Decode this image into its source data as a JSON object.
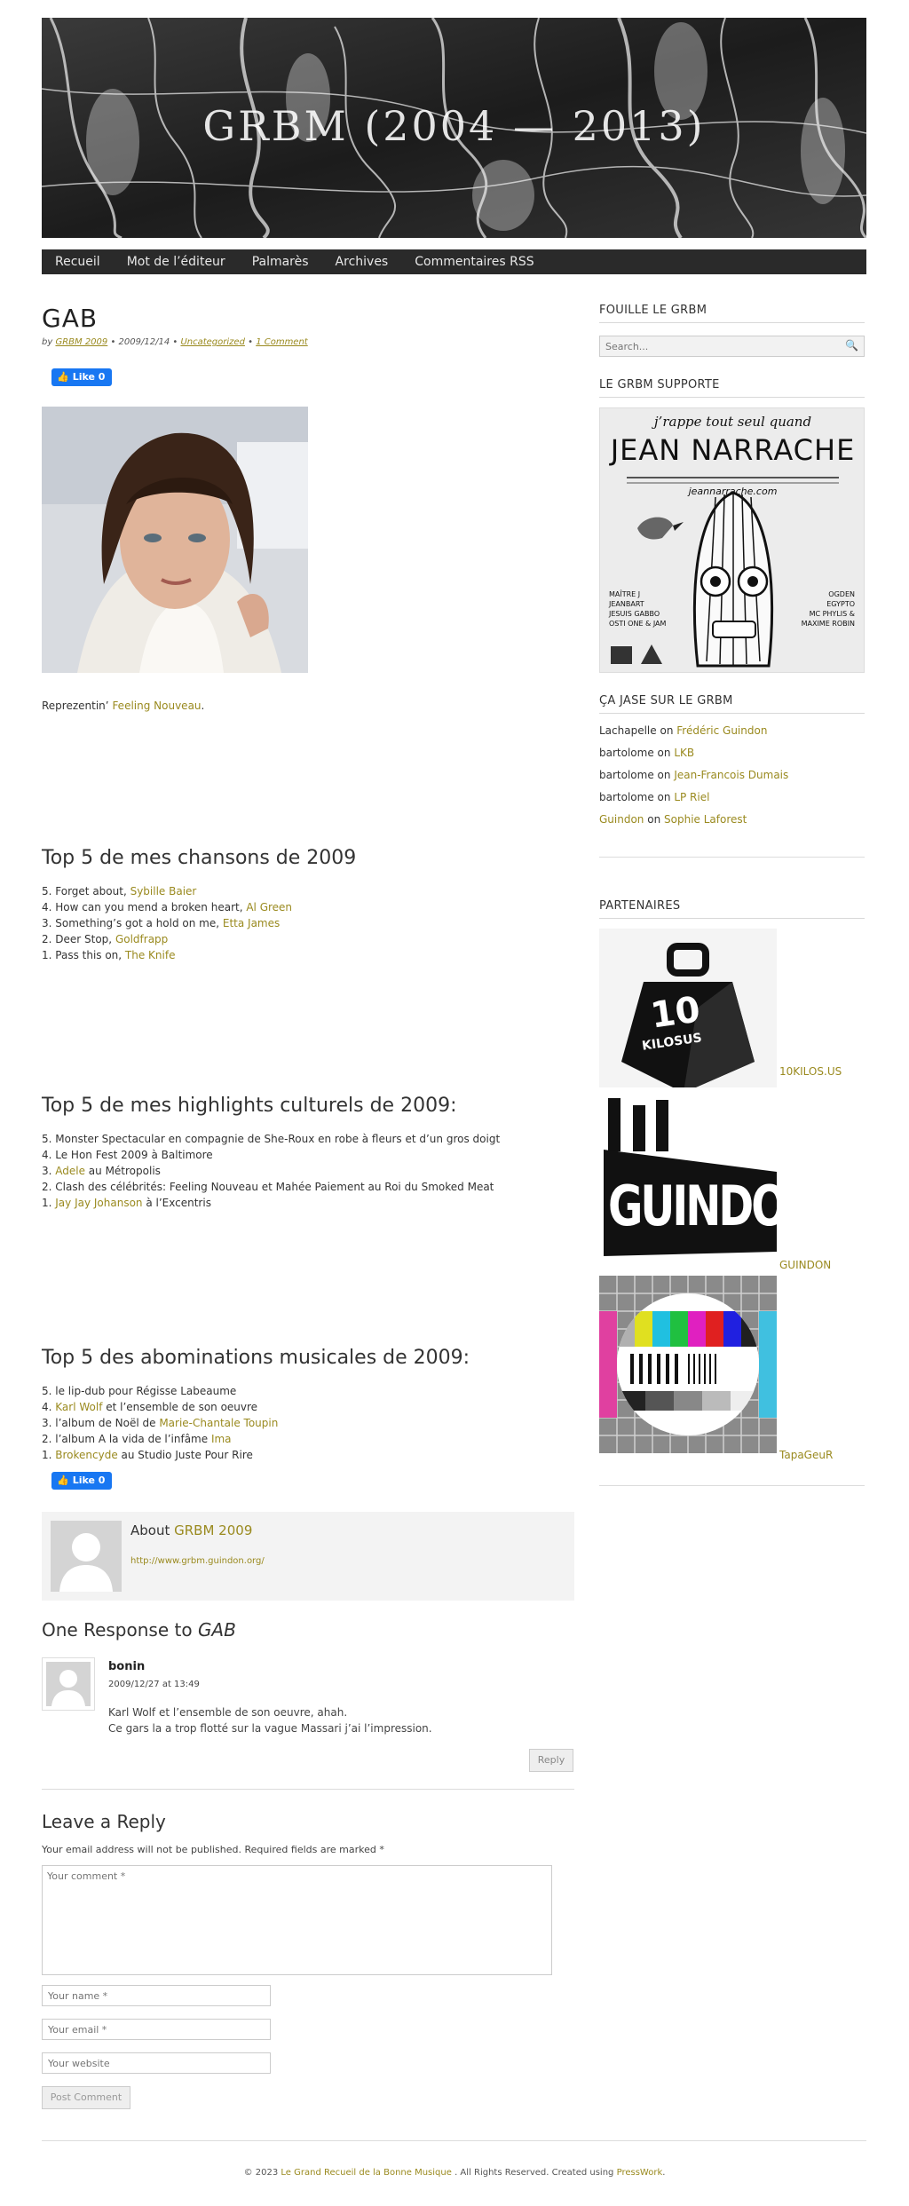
{
  "header": {
    "site_title": "GRBM (2004 — 2013)"
  },
  "nav": {
    "items": [
      "Recueil",
      "Mot de l’éditeur",
      "Palmarès",
      "Archives",
      "Commentaires RSS"
    ]
  },
  "post": {
    "title": "GAB",
    "meta": {
      "by": "by",
      "author": "GRBM 2009",
      "date": "2009/12/14",
      "category": "Uncategorized",
      "comments_link": "1 Comment"
    },
    "like_label": "Like 0",
    "intro": {
      "prefix": "Reprezentin’",
      "link": "Feeling Nouveau",
      "suffix": "."
    },
    "sections": [
      {
        "heading": "Top 5 de mes chansons de 2009",
        "items": [
          {
            "text": "5. Forget about, ",
            "link": "Sybille Baier",
            "after": ""
          },
          {
            "text": "4. How can you mend a broken heart, ",
            "link": "Al Green",
            "after": ""
          },
          {
            "text": "3. Something’s got a hold on me, ",
            "link": "Etta James",
            "after": ""
          },
          {
            "text": "2. Deer Stop, ",
            "link": "Goldfrapp",
            "after": ""
          },
          {
            "text": "1. Pass this on, ",
            "link": "The Knife",
            "after": ""
          }
        ]
      },
      {
        "heading": "Top 5 de mes highlights culturels de 2009:",
        "items": [
          {
            "text": "5. Monster Spectacular en compagnie de She-Roux en robe à fleurs et d’un gros doigt",
            "link": "",
            "after": ""
          },
          {
            "text": "4. Le Hon Fest 2009 à Baltimore",
            "link": "",
            "after": ""
          },
          {
            "text": "3. ",
            "link": "Adele",
            "after": " au Métropolis"
          },
          {
            "text": "2. Clash des célébrités: Feeling Nouveau et Mahée Paiement au Roi du Smoked Meat",
            "link": "",
            "after": ""
          },
          {
            "text": "1. ",
            "link": "Jay Jay Johanson",
            "after": " à l’Excentris"
          }
        ]
      },
      {
        "heading": "Top 5 des abominations musicales de 2009:",
        "items": [
          {
            "text": "5. le lip-dub pour Régisse Labeaume",
            "link": "",
            "after": ""
          },
          {
            "text": "4. ",
            "link": "Karl Wolf",
            "after": " et l’ensemble de son oeuvre"
          },
          {
            "text": "3. l’album de Noël de ",
            "link": "Marie-Chantale Toupin",
            "after": ""
          },
          {
            "text": "2. l’album A la vida de l’infâme ",
            "link": "Ima",
            "after": ""
          },
          {
            "text": "1. ",
            "link": "Brokencyde",
            "after": " au Studio Juste Pour Rire"
          }
        ]
      }
    ]
  },
  "author_box": {
    "about": "About",
    "name": "GRBM 2009",
    "url": "http://www.grbm.guindon.org/"
  },
  "responses": {
    "title_prefix": "One Response to",
    "title_post": "GAB",
    "comment": {
      "author": "bonin",
      "date": "2009/12/27 at 13:49",
      "lines": [
        "Karl Wolf et l’ensemble de son oeuvre, ahah.",
        "Ce gars la a trop flotté sur la vague Massari j’ai l’impression."
      ],
      "reply_label": "Reply"
    }
  },
  "reply_form": {
    "title": "Leave a Reply",
    "note": "Your email address will not be published. Required fields are marked *",
    "comment_placeholder": "Your comment *",
    "name_placeholder": "Your name *",
    "email_placeholder": "Your email *",
    "website_placeholder": "Your website",
    "submit_label": "Post Comment"
  },
  "sidebar": {
    "search_title": "FOUILLE LE GRBM",
    "search_placeholder": "Search...",
    "support_title": "LE GRBM SUPPORTE",
    "poster": {
      "tagline": "j’rappe tout seul quand",
      "name": "JEAN NARRACHE",
      "site": "jeannarrache.com",
      "left_names": [
        "MAÎTRE J",
        "JEANBART",
        "JESUIS GABBO",
        "OSTI ONE & JAM"
      ],
      "right_names": [
        "OGDEN",
        "EGYPTO",
        "MC PHYLIS &",
        "MAXIME ROBIN"
      ]
    },
    "recent_title": "ÇA JASE SUR LE GRBM",
    "recent_comments": [
      {
        "who": "Lachapelle",
        "who_link": false,
        "on": "on",
        "post": "Frédéric Guindon"
      },
      {
        "who": "bartolome",
        "who_link": false,
        "on": "on",
        "post": "LKB"
      },
      {
        "who": "bartolome",
        "who_link": false,
        "on": "on",
        "post": "Jean-Francois Dumais"
      },
      {
        "who": "bartolome",
        "who_link": false,
        "on": "on",
        "post": "LP Riel"
      },
      {
        "who": "Guindon",
        "who_link": true,
        "on": "on",
        "post": "Sophie Laforest"
      }
    ],
    "partners_title": "PARTENAIRES",
    "partners": [
      {
        "label": "10KILOS.US",
        "logo_text": "10",
        "logo_sub": "KILOSUS"
      },
      {
        "label": "GUINDON",
        "logo_text": "GUINDON"
      },
      {
        "label": "TapaGeuR"
      }
    ]
  },
  "footer": {
    "prefix": "© 2023",
    "site_link": "Le Grand Recueil de la Bonne Musique",
    "middle": ". All Rights Reserved. Created using",
    "credit_link": "PressWork",
    "suffix": "."
  },
  "colors": {
    "link": "#9a8a1f",
    "nav_bg": "#2a2a2a",
    "facebook": "#1877f2"
  }
}
